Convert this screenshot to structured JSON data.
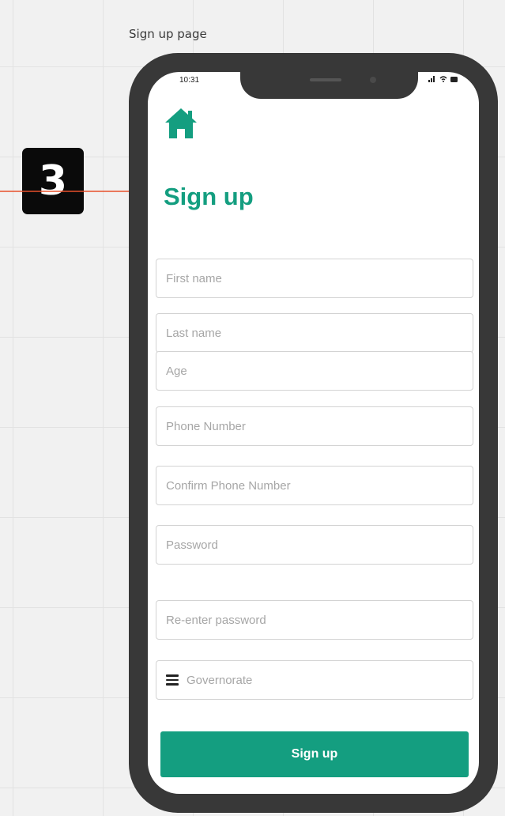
{
  "canvas": {
    "frame_label": "Sign up page",
    "step_number": "3"
  },
  "status_bar": {
    "time": "10:31",
    "icons": [
      "signal-icon",
      "wifi-icon",
      "battery-icon"
    ]
  },
  "header": {
    "home_icon": "home-icon",
    "title": "Sign up"
  },
  "form": {
    "first_name_placeholder": "First name",
    "last_name_placeholder": "Last name",
    "age_placeholder": "Age",
    "phone_placeholder": "Phone Number",
    "confirm_phone_placeholder": "Confirm Phone Number",
    "password_placeholder": "Password",
    "reenter_password_placeholder": "Re-enter password",
    "governorate_placeholder": "Governorate",
    "governorate_icon": "menu-icon",
    "submit_label": "Sign up"
  },
  "colors": {
    "brand": "#149e80",
    "connector": "#e8502a",
    "phone_frame": "#383838"
  }
}
